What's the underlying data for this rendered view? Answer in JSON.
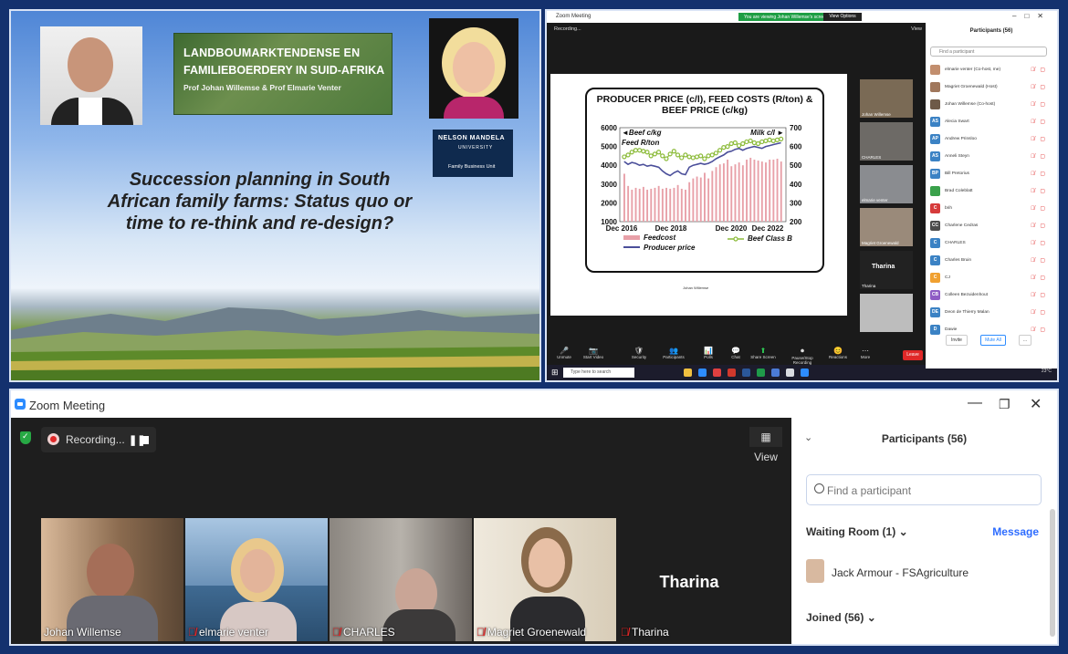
{
  "slide": {
    "logo_line1": "LANDBOUMARKTENDENSE EN",
    "logo_line2": "FAMILIEBOERDERY IN SUID-AFRIKA",
    "logo_line3": "Prof Johan Willemse & Prof Elmarie Venter",
    "nmu_line1": "NELSON MANDELA",
    "nmu_line2": "UNIVERSITY",
    "nmu_line3": "Family Business Unit",
    "title": "Succession planning in South African family farms:  Status quo or time to re-think and re-design?"
  },
  "zoom_small": {
    "window_title": "Zoom Meeting",
    "banner_text": "You are viewing Johan Willemse's screen",
    "view_options": "View Options",
    "recording": "Recording...",
    "view": "View",
    "chart_credit": "Johan Willemse",
    "thumbs": [
      {
        "name": "Johan Willemse",
        "color": "#7a6a55"
      },
      {
        "name": "CHARLES",
        "color": "#6d6a66"
      },
      {
        "name": "elmarie venter",
        "color": "#8a8c90"
      },
      {
        "name": "Magriet Groenewald",
        "color": "#9a8a7a"
      },
      {
        "name": "Tharina",
        "color": "#222222"
      },
      {
        "name": "",
        "color": "#bdbdbd"
      }
    ],
    "tharina_label": "Tharina",
    "toolbar": [
      {
        "icon": "🎤",
        "label": "Unmute"
      },
      {
        "icon": "📷",
        "label": "Start Video"
      },
      {
        "icon": "🛡",
        "label": "Security"
      },
      {
        "icon": "👥",
        "label": "Participants"
      },
      {
        "icon": "📊",
        "label": "Polls"
      },
      {
        "icon": "💬",
        "label": "Chat"
      },
      {
        "icon": "⬆",
        "label": "Share Screen"
      },
      {
        "icon": "⏺",
        "label": "Pause/Stop Recording"
      },
      {
        "icon": "😊",
        "label": "Reactions"
      },
      {
        "icon": "⋯",
        "label": "More"
      }
    ],
    "leave": "Leave",
    "taskbar_search": "Type here to search",
    "tray_temp": "23°C",
    "participants_title": "Participants (56)",
    "find_placeholder": "Find a participant",
    "participants": [
      {
        "initials": "",
        "name": "elmarie venter (Co-host, me)",
        "color": "#c28e6e"
      },
      {
        "initials": "",
        "name": "Magriet Groenewald (Host)",
        "color": "#a0775c"
      },
      {
        "initials": "",
        "name": "Johan Willemse (Co-host)",
        "color": "#6e5a48"
      },
      {
        "initials": "AS",
        "name": "Alecia Swart",
        "color": "#3b82c4"
      },
      {
        "initials": "AP",
        "name": "Andrew Prinsloo",
        "color": "#3b82c4"
      },
      {
        "initials": "AS",
        "name": "Anneli Steyn",
        "color": "#3b82c4"
      },
      {
        "initials": "BP",
        "name": "Bill Pretorius",
        "color": "#3b82c4"
      },
      {
        "initials": "",
        "name": "Brad Coleblatt",
        "color": "#3aa14b"
      },
      {
        "initials": "C",
        "name": "brih",
        "color": "#d63b3b"
      },
      {
        "initials": "CC",
        "name": "Charlene Cedras",
        "color": "#4b4b4b"
      },
      {
        "initials": "C",
        "name": "CHARLES",
        "color": "#3b82c4"
      },
      {
        "initials": "C",
        "name": "Charles Bruin",
        "color": "#3b82c4"
      },
      {
        "initials": "C",
        "name": "CJ",
        "color": "#f0a030"
      },
      {
        "initials": "CB",
        "name": "Colleen Bezuidenhout",
        "color": "#8e5cc4"
      },
      {
        "initials": "DE",
        "name": "Deon de Thierry Malan",
        "color": "#3b82c4"
      },
      {
        "initials": "D",
        "name": "Dawie",
        "color": "#3b82c4"
      }
    ],
    "invite": "Invite",
    "mute_all": "Mute All"
  },
  "zoom_big": {
    "window_title": "Zoom Meeting",
    "recording": "Recording...",
    "view": "View",
    "tiles": [
      {
        "name": "Johan Willemse",
        "muted": false,
        "bg": "#8b6b4f"
      },
      {
        "name": "elmarie venter",
        "muted": true,
        "bg": "#6c8ba6"
      },
      {
        "name": "CHARLES",
        "muted": true,
        "bg": "#7b7570"
      },
      {
        "name": "Magriet Groenewald",
        "muted": true,
        "bg": "#bca98a"
      },
      {
        "name": "Tharina",
        "muted": true,
        "bg": "#1e1e1e"
      }
    ],
    "tharina_label": "Tharina",
    "participants_title": "Participants (56)",
    "find_placeholder": "Find a participant",
    "waiting_room": "Waiting Room (1)",
    "message": "Message",
    "waiting_name": "Jack Armour - FSAgriculture",
    "joined": "Joined (56)"
  },
  "chart_data": {
    "type": "line",
    "title": "PRODUCER PRICE (c/l), FEED COSTS (R/ton) & BEEF  PRICE (c/kg)",
    "left_axis_label": "◄Beef c/kg",
    "left_axis_label2": "Feed R/ton",
    "right_axis_label": "Milk c/l ►",
    "x_ticks": [
      "Dec 2016",
      "Dec 2018",
      "Dec 2020",
      "Dec 2022"
    ],
    "y_left_ticks": [
      6000,
      5000,
      4000,
      3000,
      2000,
      1000
    ],
    "y_right_ticks": [
      700,
      600,
      500,
      400,
      300,
      200
    ],
    "ylim_left": [
      1000,
      6000
    ],
    "ylim_right": [
      200,
      700
    ],
    "series": [
      {
        "name": "Feedcost",
        "axis": "left",
        "kind": "bar",
        "color": "#e8a0a8",
        "values": [
          3550,
          2900,
          2700,
          2800,
          2750,
          2850,
          2700,
          2750,
          2800,
          2900,
          2750,
          2800,
          2750,
          2800,
          2950,
          2750,
          2700,
          3100,
          3300,
          3400,
          3350,
          3600,
          3300,
          3700,
          3900,
          4050,
          4100,
          4300,
          3950,
          4050,
          4150,
          4000,
          4300,
          4400,
          4300,
          4250,
          4200,
          4150,
          4300,
          4300,
          4350,
          4200
        ]
      },
      {
        "name": "Producer price",
        "axis": "right",
        "kind": "line",
        "color": "#4b4f9a",
        "values": [
          520,
          505,
          515,
          510,
          500,
          505,
          495,
          500,
          495,
          490,
          470,
          455,
          445,
          460,
          470,
          455,
          450,
          490,
          500,
          505,
          510,
          505,
          510,
          520,
          535,
          545,
          555,
          570,
          575,
          585,
          590,
          580,
          590,
          595,
          600,
          595,
          590,
          600,
          605,
          610,
          615,
          620
        ]
      },
      {
        "name": "Beef Class B",
        "axis": "left",
        "kind": "line-marker",
        "color": "#8cbb3a",
        "values": [
          4450,
          4550,
          4700,
          4800,
          4800,
          4750,
          4700,
          4500,
          4600,
          4700,
          4500,
          4350,
          4600,
          4750,
          4550,
          4400,
          4550,
          4450,
          4400,
          4450,
          4500,
          4350,
          4500,
          4550,
          4650,
          4800,
          4950,
          5000,
          5150,
          5200,
          5050,
          5150,
          5250,
          5300,
          5200,
          5150,
          5250,
          5300,
          5350,
          5300,
          5350,
          5400
        ]
      }
    ]
  }
}
